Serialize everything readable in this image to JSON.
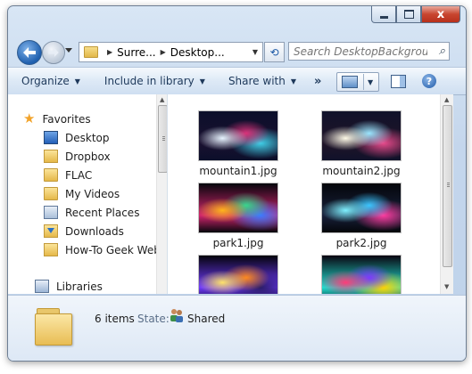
{
  "window": {
    "caption_buttons": {
      "minimize": "minimize",
      "maximize": "maximize",
      "close": "x"
    }
  },
  "address": {
    "crumbs": [
      "Surre...",
      "Desktop..."
    ],
    "search_placeholder": "Search DesktopBackground"
  },
  "toolbar": {
    "organize": "Organize",
    "include_in_library": "Include in library",
    "share_with": "Share with",
    "more": "»"
  },
  "nav": {
    "favorites_label": "Favorites",
    "favorites": [
      {
        "label": "Desktop",
        "icon": "desktop-icon"
      },
      {
        "label": "Dropbox",
        "icon": "dropbox-folder-icon"
      },
      {
        "label": "FLAC",
        "icon": "folder-icon"
      },
      {
        "label": "My Videos",
        "icon": "folder-icon"
      },
      {
        "label": "Recent Places",
        "icon": "recent-places-icon"
      },
      {
        "label": "Downloads",
        "icon": "downloads-icon"
      },
      {
        "label": "How-To Geek Webs",
        "icon": "folder-icon"
      }
    ],
    "libraries_label": "Libraries"
  },
  "files": [
    {
      "name": "mountain1.jpg",
      "colors": [
        "#0b0f2a",
        "#e8f4ff",
        "#d9337a",
        "#3fd0e8",
        "#1a1030"
      ]
    },
    {
      "name": "mountain2.jpg",
      "colors": [
        "#10122a",
        "#fffbe8",
        "#9ae6ff",
        "#e74a8c",
        "#201428"
      ]
    },
    {
      "name": "park1.jpg",
      "colors": [
        "#05060c",
        "#ffb51c",
        "#38d68c",
        "#3a7bff",
        "#d2256e"
      ]
    },
    {
      "name": "park2.jpg",
      "colors": [
        "#04060a",
        "#7ff0ff",
        "#3ac6ff",
        "#ff3ca0",
        "#18203a"
      ]
    },
    {
      "name": "",
      "colors": [
        "#05040c",
        "#ffe36a",
        "#ff8a1e",
        "#2a1c66",
        "#6f3aff"
      ]
    },
    {
      "name": "",
      "colors": [
        "#0a0510",
        "#ff3b7a",
        "#7d38ff",
        "#ffd400",
        "#20e0d0"
      ]
    }
  ],
  "details": {
    "item_count": "6 items",
    "state_label": "State:",
    "state_value": "Shared"
  }
}
